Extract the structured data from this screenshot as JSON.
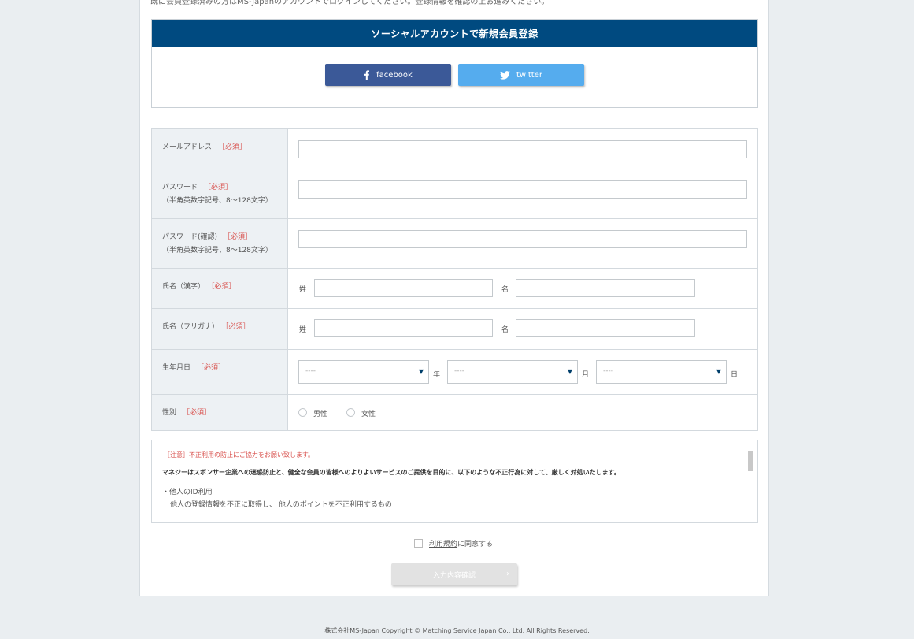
{
  "top_cut_text": "既に会員登録済みの方はMS-Japanのアカウントでログインしてください。登録情報を確認の上お進みください。",
  "social": {
    "title": "ソーシャルアカウントで新規会員登録",
    "facebook_label": "facebook",
    "twitter_label": "twitter",
    "facebook_color": "#3b5998",
    "twitter_color": "#55acee",
    "header_color": "#004a80"
  },
  "form": {
    "required_mark": "［必須］",
    "email_label": "メールアドレス",
    "password_label": "パスワード",
    "password_note": "（半角英数字記号、8～128文字）",
    "password_confirm_label": "パスワード(確認)",
    "password_confirm_note": "（半角英数字記号、8～128文字）",
    "name_kanji_label": "氏名（漢字）",
    "name_kana_label": "氏名（フリガナ）",
    "last_name_prefix": "姓",
    "first_name_prefix": "名",
    "birthday_label": "生年月日",
    "year_value": "----",
    "month_value": "----",
    "day_value": "----",
    "year_suffix": "年",
    "month_suffix": "月",
    "day_suffix": "日",
    "gender_label": "性別",
    "male_label": "男性",
    "female_label": "女性"
  },
  "notice": {
    "title": "［注意］不正利用の防止にご協力をお願い致します。",
    "body": "マネジーはスポンサー企業への迷惑防止と、健全な会員の皆様へのよりよいサービスのご提供を目的に、以下のような不正行為に対して、厳しく対処いたします。",
    "item1": "・他人のID利用",
    "item1_detail": "他人の登録情報を不正に取得し、 他人のポイントを不正利用するもの"
  },
  "agree": {
    "link_text": "利用規約",
    "suffix": "に同意する"
  },
  "submit_label": "入力内容確認",
  "footer": "株式会社MS-Japan Copyright © Matching Service Japan Co., Ltd. All Rights Reserved."
}
